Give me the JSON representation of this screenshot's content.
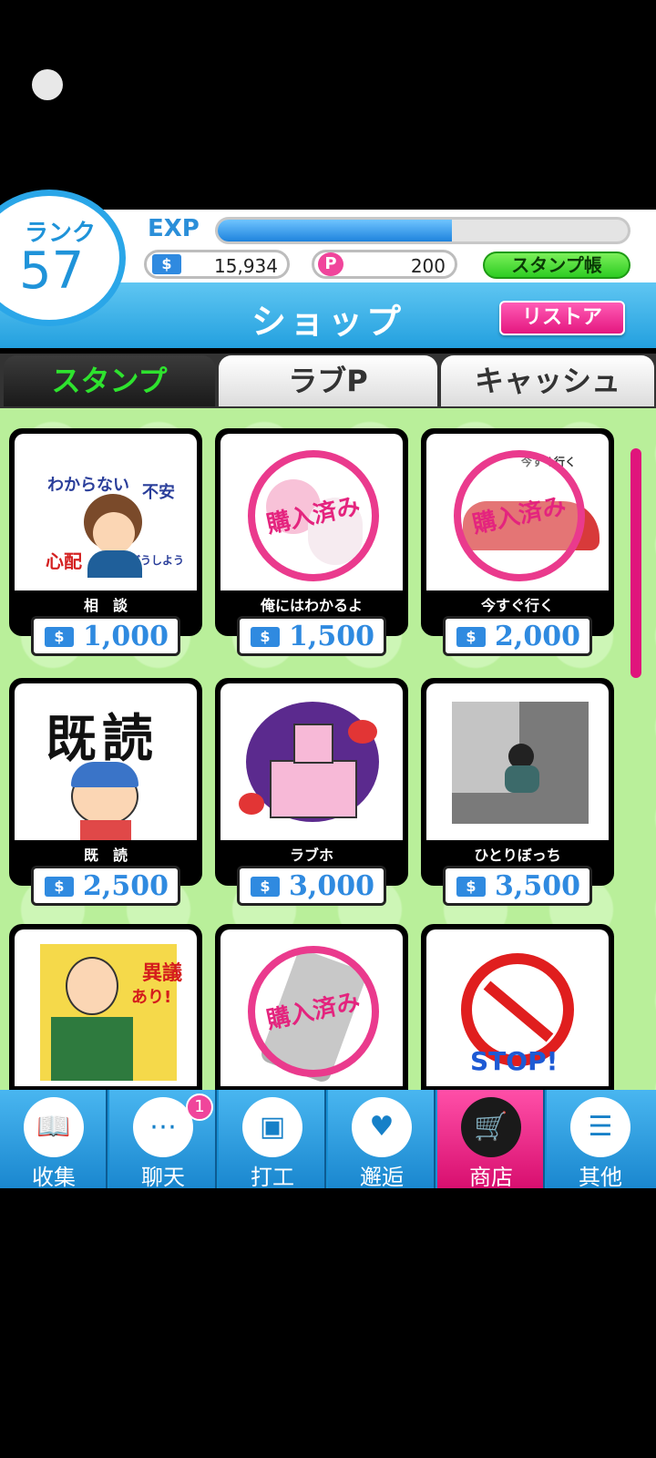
{
  "header": {
    "rank_label": "ランク",
    "rank_value": "57",
    "exp_label": "EXP",
    "exp_progress": 0.57,
    "money": "15,934",
    "love_points": "200",
    "money_icon": "$",
    "love_icon": "P",
    "stamp_book_label": "スタンプ帳"
  },
  "titlebar": {
    "title": "ショップ",
    "restore_label": "リストア"
  },
  "tabs": [
    {
      "label": "スタンプ",
      "active": true
    },
    {
      "label": "ラブP",
      "active": false
    },
    {
      "label": "キャッシュ",
      "active": false
    }
  ],
  "stamps": [
    {
      "name": "相　談",
      "price": "1,000",
      "purchased": false,
      "art": [
        "わからない",
        "不安",
        "心配",
        "どうしよう"
      ]
    },
    {
      "name": "俺にはわかるよ",
      "price": "1,500",
      "purchased": true,
      "art": []
    },
    {
      "name": "今すぐ行く",
      "price": "2,000",
      "purchased": true,
      "art": [
        "今すぐ行く"
      ]
    },
    {
      "name": "既　読",
      "price": "2,500",
      "purchased": false,
      "art": [
        "既読"
      ]
    },
    {
      "name": "ラブホ",
      "price": "3,000",
      "purchased": false,
      "art": []
    },
    {
      "name": "ひとりぼっち",
      "price": "3,500",
      "purchased": false,
      "art": []
    },
    {
      "name": "",
      "price": "",
      "purchased": false,
      "art": [
        "異議",
        "あり!"
      ]
    },
    {
      "name": "",
      "price": "",
      "purchased": true,
      "art": []
    },
    {
      "name": "",
      "price": "",
      "purchased": false,
      "art": [
        "STOP!"
      ]
    }
  ],
  "purchased_label": "購入済み",
  "nav": [
    {
      "label": "收集",
      "icon": "book-icon"
    },
    {
      "label": "聊天",
      "icon": "chat-icon",
      "badge": "1"
    },
    {
      "label": "打工",
      "icon": "briefcase-icon"
    },
    {
      "label": "邂逅",
      "icon": "keyhole-heart-icon"
    },
    {
      "label": "商店",
      "icon": "cart-icon",
      "active": true
    },
    {
      "label": "其他",
      "icon": "menu-list-icon"
    }
  ],
  "colors": {
    "accent_blue": "#2aa6e8",
    "accent_pink": "#e4177f",
    "tab_active_green": "#2ee32e",
    "grid_bg": "#b9ef9a"
  }
}
